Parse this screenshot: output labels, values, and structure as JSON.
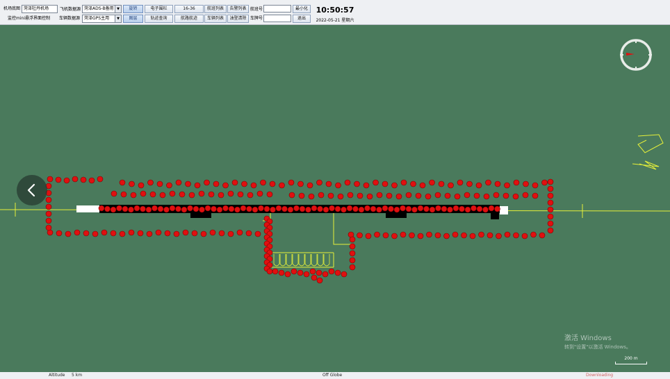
{
  "toolbar": {
    "row1": {
      "airport_map_label": "机场底图",
      "airport_map_value": "菏泽牡丹机场",
      "aircraft_source_label": "飞机数据源",
      "aircraft_source_value": "菏泽ADS-B备用",
      "rotate": "旋转",
      "fence": "电子围栏",
      "runway": "16-36",
      "flight_list": "航班列表",
      "warning_list": "告警列表",
      "flight_no_label": "航班号",
      "minimize": "最小化"
    },
    "row2": {
      "monitor_label": "监控mini悬浮界面控制",
      "vehicle_source_label": "车辆数据源",
      "vehicle_source_value": "菏泽GPS主用",
      "layers": "图层",
      "track_query": "轨迹查询",
      "route_draw": "航路航迹",
      "vehicle_list": "车辆列表",
      "fuel_list": "油登清除",
      "plate_no_label": "车牌号",
      "exit": "退出"
    },
    "clock": "10:50:57",
    "date": "2022-05-21  星期六"
  },
  "map": {
    "background_color": "#4a7a5c",
    "marker_color": "#e01010",
    "runway_color": "#000000",
    "line_color": "#e6f03a",
    "back_icon": "chevron-left-icon",
    "compass_icon": "compass-icon"
  },
  "watermark": {
    "line1": "激活 Windows",
    "line2": "转到\"设置\"以激活 Windows。"
  },
  "scale": "200 m",
  "status": {
    "altitude_label": "Altitude",
    "altitude_value": "5 km",
    "globe_mode": "Off Globe",
    "loading": "Downloading"
  }
}
